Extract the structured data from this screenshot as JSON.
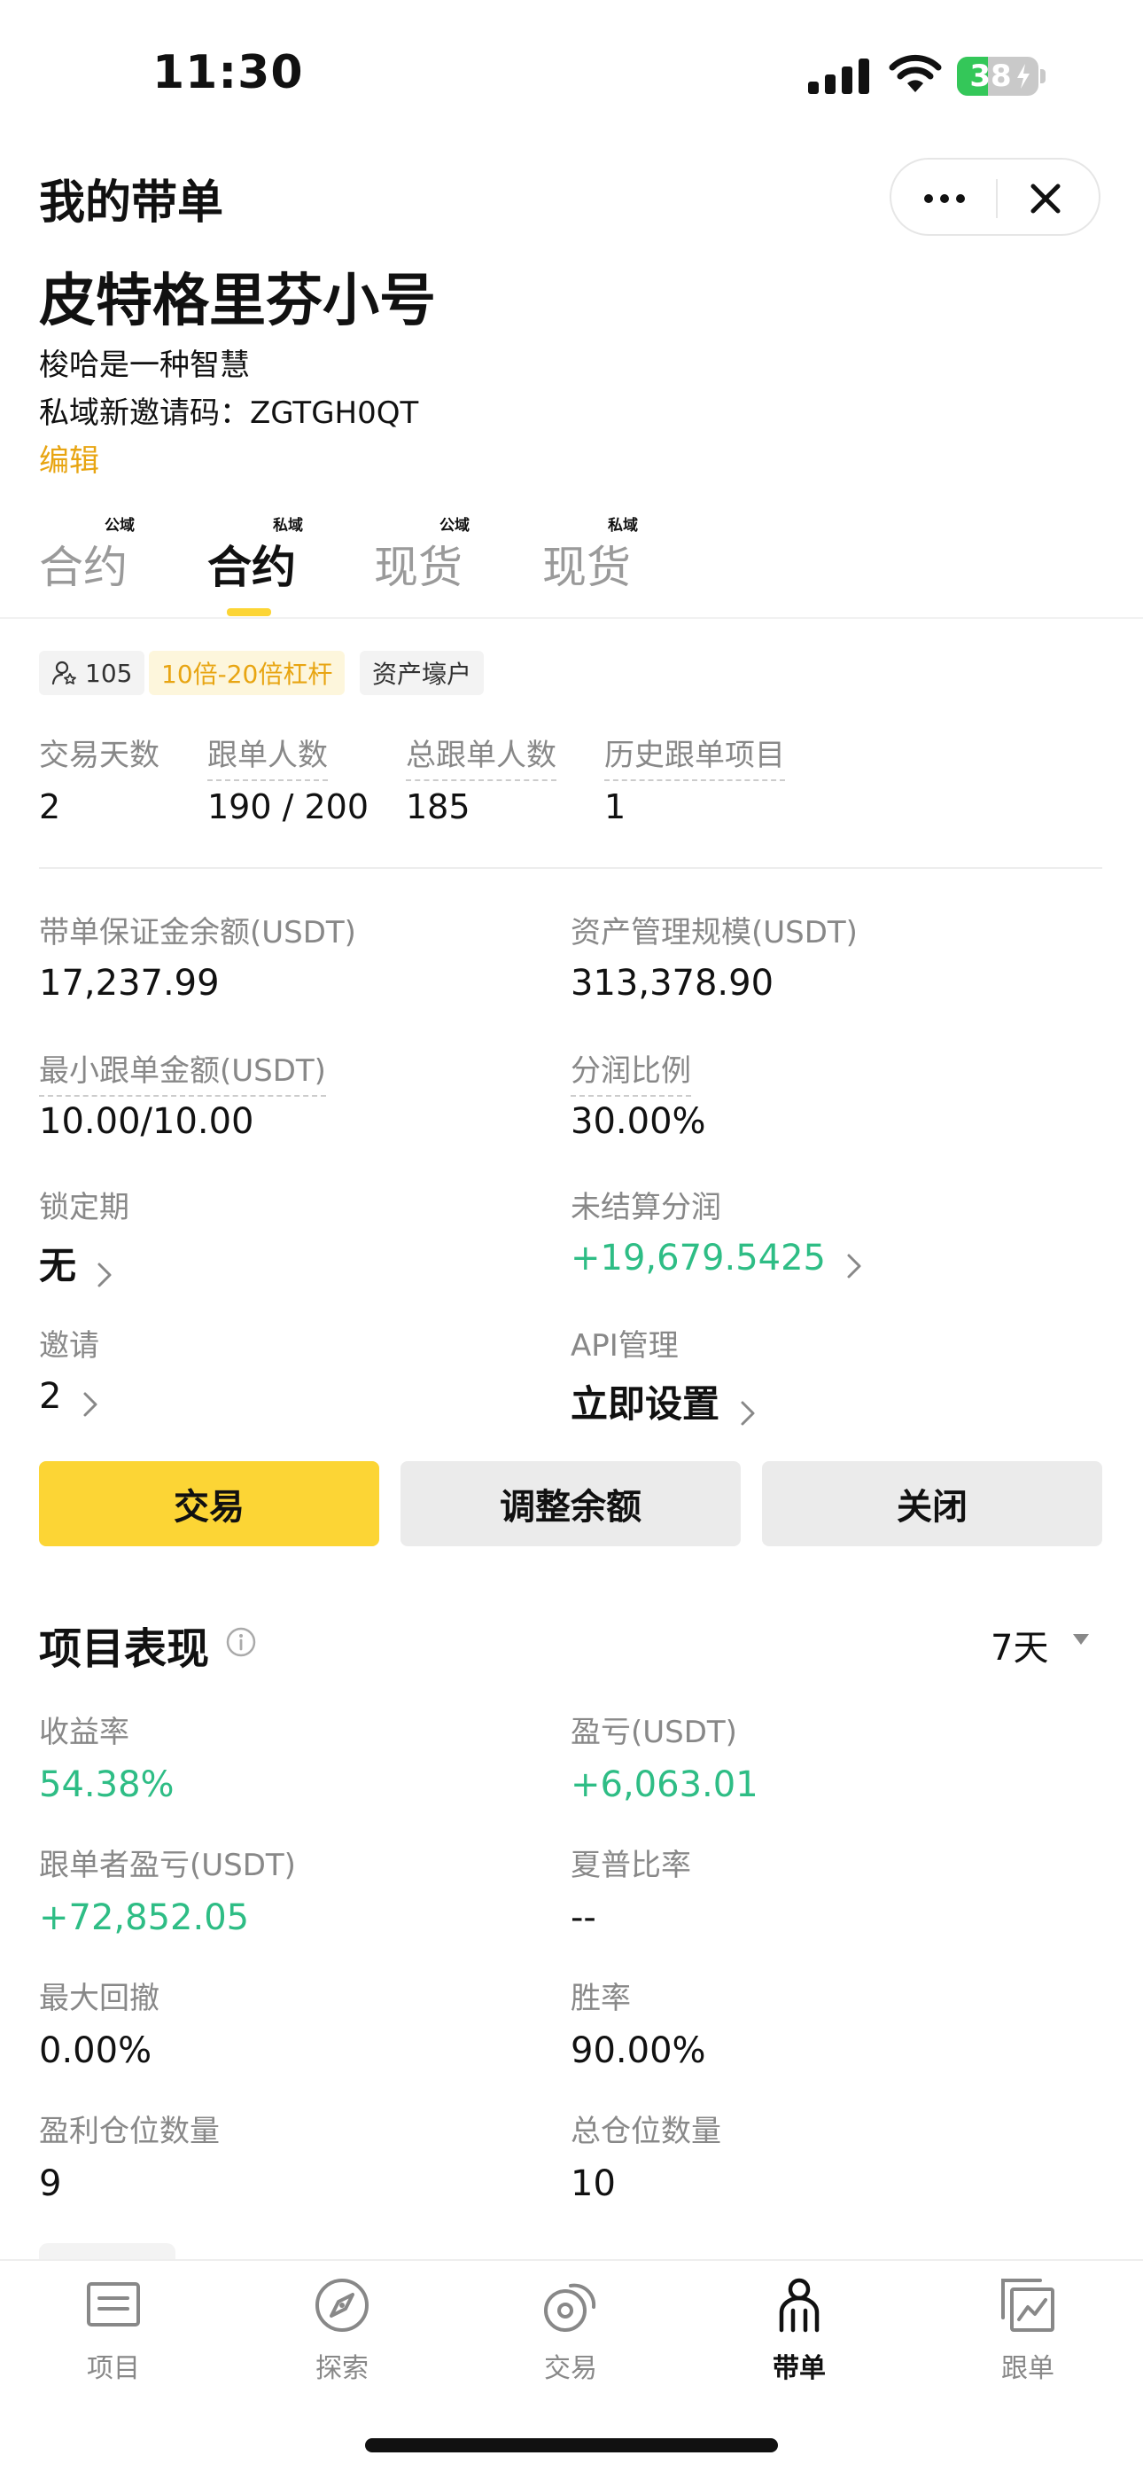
{
  "status_bar": {
    "time": "11:30",
    "battery": "38",
    "battery_level": 0.38
  },
  "header": {
    "title": "我的带单"
  },
  "profile": {
    "nickname": "皮特格里芬小号",
    "motto": "梭哈是一种智慧",
    "invite_label": "私域新邀请码：",
    "invite_code": "ZGTGH0QT",
    "edit_label": "编辑"
  },
  "tabs": [
    {
      "label": "合约",
      "badge": "公域"
    },
    {
      "label": "合约",
      "badge": "私域"
    },
    {
      "label": "现货",
      "badge": "公域"
    },
    {
      "label": "现货",
      "badge": "私域"
    }
  ],
  "tags": {
    "followers": "105",
    "leverage": "10倍-20倍杠杆",
    "asset": "资产壕户"
  },
  "stats": [
    {
      "label": "交易天数",
      "value": "2"
    },
    {
      "label": "跟单人数",
      "value": "190 / 200"
    },
    {
      "label": "总跟单人数",
      "value": "185"
    },
    {
      "label": "历史跟单项目",
      "value": "1"
    }
  ],
  "account": {
    "margin_label": "带单保证金余额(USDT)",
    "margin_value": "17,237.99",
    "aum_label": "资产管理规模(USDT)",
    "aum_value": "313,378.90",
    "min_label": "最小跟单金额(USDT)",
    "min_value": "10.00/10.00",
    "share_label": "分润比例",
    "share_value": "30.00%",
    "lock_label": "锁定期",
    "lock_value": "无",
    "unsettled_label": "未结算分润",
    "unsettled_value": "+19,679.5425",
    "invite_label": "邀请",
    "invite_value": "2",
    "api_label": "API管理",
    "api_value": "立即设置"
  },
  "actions": {
    "trade": "交易",
    "adjust": "调整余额",
    "close": "关闭"
  },
  "performance": {
    "title": "项目表现",
    "period": "7天",
    "roi_label": "收益率",
    "roi_value": "54.38%",
    "pnl_label": "盈亏(USDT)",
    "pnl_value": "+6,063.01",
    "follower_pnl_label": "跟单者盈亏(USDT)",
    "follower_pnl_value": "+72,852.05",
    "sharpe_label": "夏普比率",
    "sharpe_value": "--",
    "mdd_label": "最大回撤",
    "mdd_value": "0.00%",
    "winrate_label": "胜率",
    "winrate_value": "90.00%",
    "win_pos_label": "盈利仓位数量",
    "win_pos_value": "9",
    "total_pos_label": "总仓位数量",
    "total_pos_value": "10"
  },
  "nav": [
    {
      "label": "项目",
      "icon": "project-icon"
    },
    {
      "label": "探索",
      "icon": "compass-icon"
    },
    {
      "label": "交易",
      "icon": "trade-icon"
    },
    {
      "label": "带单",
      "icon": "lead-icon"
    },
    {
      "label": "跟单",
      "icon": "copy-icon"
    }
  ],
  "colors": {
    "accent": "#fcd535",
    "positive": "#2ebd85",
    "link": "#e8a512"
  }
}
